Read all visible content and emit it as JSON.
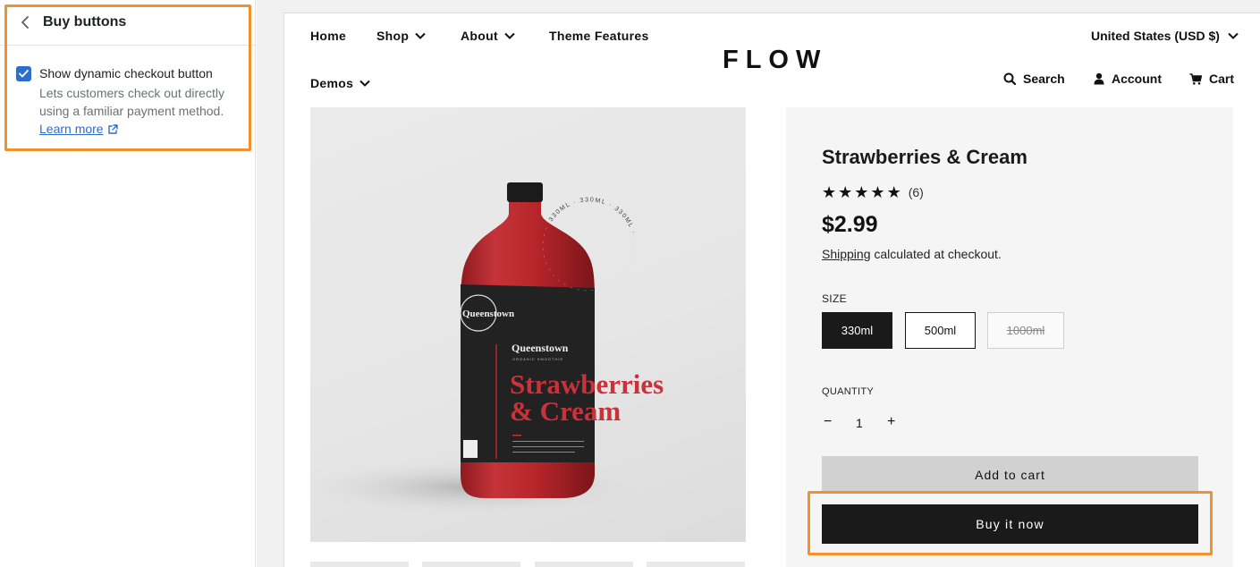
{
  "panel": {
    "title": "Buy buttons",
    "back_icon": "chevron-left-icon",
    "setting": {
      "checked": true,
      "label": "Show dynamic checkout button",
      "help": "Lets customers check out directly using a familiar payment method.",
      "learn_more": "Learn more"
    }
  },
  "store": {
    "nav": {
      "home": "Home",
      "shop": "Shop",
      "about": "About",
      "theme_features": "Theme Features",
      "demos": "Demos"
    },
    "logo": "FLOW",
    "currency": "United States (USD $)",
    "utilities": {
      "search": "Search",
      "account": "Account",
      "cart": "Cart"
    }
  },
  "product": {
    "title": "Strawberries & Cream",
    "rating_stars": 5,
    "rating_count": "(6)",
    "price": "$2.99",
    "shipping_link": "Shipping",
    "shipping_rest": " calculated at checkout.",
    "size_label": "SIZE",
    "sizes": [
      "330ml",
      "500ml",
      "1000ml"
    ],
    "selected_size": "330ml",
    "unavailable_size": "1000ml",
    "quantity_label": "QUANTITY",
    "quantity_minus": "−",
    "quantity": "1",
    "quantity_plus": "+",
    "add_to_cart": "Add to cart",
    "buy_now": "Buy it now",
    "bottle": {
      "brand": "Queenstown",
      "sub": "ORGANIC SMOOTHIE",
      "name_line1": "Strawberries",
      "name_line2": "& Cream",
      "ring_text": "330ML · 330ML · 330ML ·",
      "seal_text": "Queenstown"
    }
  },
  "colors": {
    "highlight": "#f3902f",
    "accent_blue": "#2c6ecb",
    "bottle_red": "#b8262b",
    "button_dark": "#1a1a1a"
  }
}
